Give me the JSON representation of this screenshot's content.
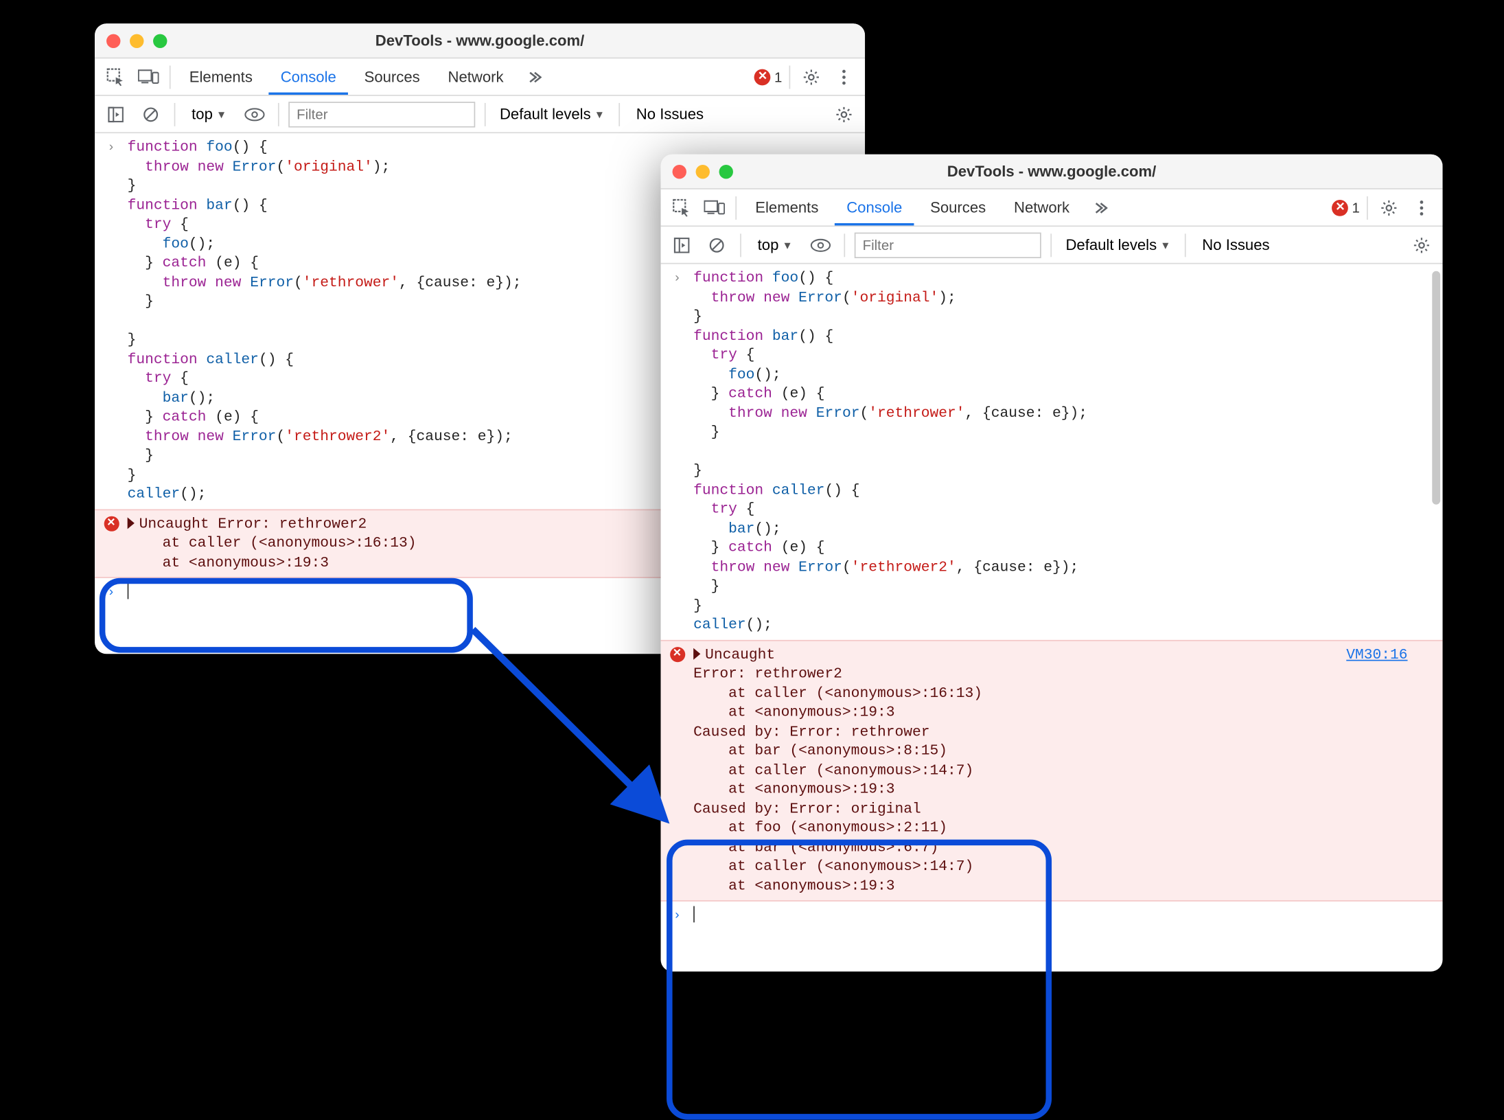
{
  "window1": {
    "title": "DevTools - www.google.com/",
    "tabs": [
      "Elements",
      "Console",
      "Sources",
      "Network"
    ],
    "active_tab": 1,
    "error_count": "1",
    "toolbar": {
      "context": "top",
      "filter_placeholder": "Filter",
      "levels": "Default levels",
      "issues": "No Issues"
    },
    "code_lines": [
      {
        "t": "fn_decl",
        "parts": [
          [
            "kw",
            "function "
          ],
          [
            "fn",
            "foo"
          ],
          [
            "plain",
            "() {"
          ]
        ]
      },
      {
        "t": "indent1",
        "parts": [
          [
            "kw",
            "  throw new "
          ],
          [
            "fn",
            "Error"
          ],
          [
            "plain",
            "("
          ],
          [
            "str",
            "'original'"
          ],
          [
            "plain",
            ");"
          ]
        ]
      },
      {
        "t": "close",
        "parts": [
          [
            "plain",
            "}"
          ]
        ]
      },
      {
        "t": "fn_decl",
        "parts": [
          [
            "kw",
            "function "
          ],
          [
            "fn",
            "bar"
          ],
          [
            "plain",
            "() {"
          ]
        ]
      },
      {
        "t": "indent1",
        "parts": [
          [
            "kw",
            "  try "
          ],
          [
            "plain",
            "{"
          ]
        ]
      },
      {
        "t": "indent2",
        "parts": [
          [
            "fn",
            "    foo"
          ],
          [
            "plain",
            "();"
          ]
        ]
      },
      {
        "t": "indent1",
        "parts": [
          [
            "plain",
            "  } "
          ],
          [
            "catchkw",
            "catch "
          ],
          [
            "plain",
            "(e) {"
          ]
        ]
      },
      {
        "t": "indent2",
        "parts": [
          [
            "kw",
            "    throw new "
          ],
          [
            "fn",
            "Error"
          ],
          [
            "plain",
            "("
          ],
          [
            "str",
            "'rethrower'"
          ],
          [
            "plain",
            ", {cause: e});"
          ]
        ]
      },
      {
        "t": "indent1",
        "parts": [
          [
            "plain",
            "  }"
          ]
        ]
      },
      {
        "t": "blank",
        "parts": [
          [
            "plain",
            ""
          ]
        ]
      },
      {
        "t": "close",
        "parts": [
          [
            "plain",
            "}"
          ]
        ]
      },
      {
        "t": "fn_decl",
        "parts": [
          [
            "kw",
            "function "
          ],
          [
            "fn",
            "caller"
          ],
          [
            "plain",
            "() {"
          ]
        ]
      },
      {
        "t": "indent1",
        "parts": [
          [
            "kw",
            "  try "
          ],
          [
            "plain",
            "{"
          ]
        ]
      },
      {
        "t": "indent2",
        "parts": [
          [
            "fn",
            "    bar"
          ],
          [
            "plain",
            "();"
          ]
        ]
      },
      {
        "t": "indent1",
        "parts": [
          [
            "plain",
            "  } "
          ],
          [
            "catchkw",
            "catch "
          ],
          [
            "plain",
            "(e) {"
          ]
        ]
      },
      {
        "t": "indent1",
        "parts": [
          [
            "kw",
            "  throw new "
          ],
          [
            "fn",
            "Error"
          ],
          [
            "plain",
            "("
          ],
          [
            "str",
            "'rethrower2'"
          ],
          [
            "plain",
            ", {cause: e});"
          ]
        ]
      },
      {
        "t": "indent1",
        "parts": [
          [
            "plain",
            "  }"
          ]
        ]
      },
      {
        "t": "close",
        "parts": [
          [
            "plain",
            "}"
          ]
        ]
      },
      {
        "t": "call",
        "parts": [
          [
            "fn",
            "caller"
          ],
          [
            "plain",
            "();"
          ]
        ]
      }
    ],
    "error": {
      "header": "Uncaught Error: rethrower2",
      "stack": [
        "    at caller (<anonymous>:16:13)",
        "    at <anonymous>:19:3"
      ]
    }
  },
  "window2": {
    "title": "DevTools - www.google.com/",
    "tabs": [
      "Elements",
      "Console",
      "Sources",
      "Network"
    ],
    "active_tab": 1,
    "error_count": "1",
    "toolbar": {
      "context": "top",
      "filter_placeholder": "Filter",
      "levels": "Default levels",
      "issues": "No Issues"
    },
    "error": {
      "header": "Uncaught",
      "link": "VM30:16",
      "stack": [
        "Error: rethrower2",
        "    at caller (<anonymous>:16:13)",
        "    at <anonymous>:19:3",
        "Caused by: Error: rethrower",
        "    at bar (<anonymous>:8:15)",
        "    at caller (<anonymous>:14:7)",
        "    at <anonymous>:19:3",
        "Caused by: Error: original",
        "    at foo (<anonymous>:2:11)",
        "    at bar (<anonymous>:6:7)",
        "    at caller (<anonymous>:14:7)",
        "    at <anonymous>:19:3"
      ]
    }
  }
}
